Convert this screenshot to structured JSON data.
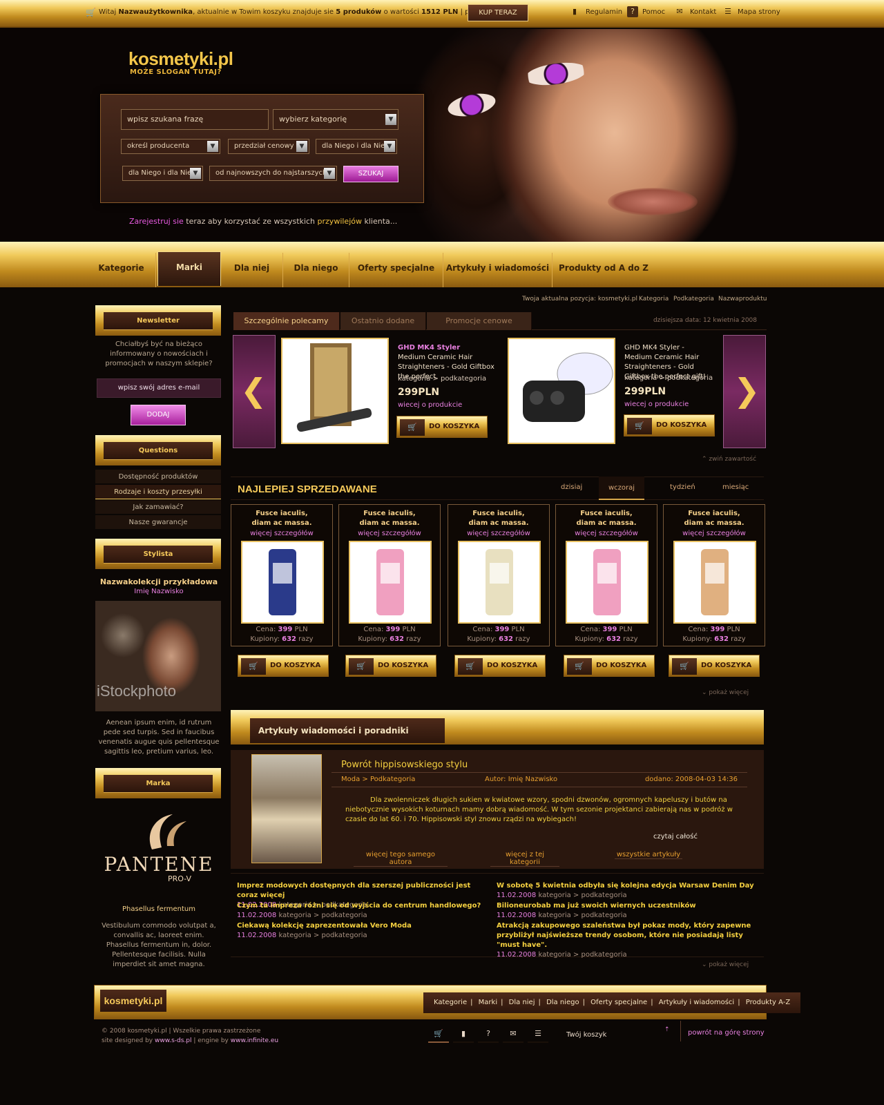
{
  "topbar": {
    "greeting_pre": "Witaj ",
    "greeting_user": "Nazwaużytkownika",
    "greeting_mid": ", aktualnie w Towim koszyku znajduje sie ",
    "greeting_count": "5 produków",
    "greeting_value_pre": " o wartości ",
    "greeting_value": "1512 PLN",
    "greeting_show": "  |  pokaż",
    "buy_now": "KUP TERAZ",
    "regulamin": "Regulamin",
    "pomoc": "Pomoc",
    "kontakt": "Kontakt",
    "mapa": "Mapa strony"
  },
  "header": {
    "logo": "kosmetyki.pl",
    "slogan": "MOŻE SLOGAN TUTAJ?"
  },
  "search": {
    "phrase": "wpisz szukana frazę",
    "category": "wybierz kategorię",
    "producer": "określ producenta",
    "price": "przedział cenowy",
    "gender1": "dla Niego i dla Niej",
    "gender2": "dla Niego i dla Niej",
    "sort": "od najnowszych do najstarszych",
    "button": "SZUKAJ"
  },
  "register": {
    "link": "Zarejestruj sie",
    "mid": " teraz aby korzystać ze wszystkich ",
    "priv": "przywilejów",
    "end": " klienta..."
  },
  "nav": {
    "items": [
      "Kategorie",
      "Marki",
      "Dla niej",
      "Dla niego",
      "Oferty specjalne",
      "Artykuły i wiadomości",
      "Produkty od A do Z"
    ],
    "active": "Marki"
  },
  "breadcrumb": {
    "prefix": "Twoja aktualna pozycja: kosmetyki.pl",
    "items": [
      "Kategoria",
      "Podkategoria",
      "Nazwaproduktu"
    ]
  },
  "sidebar": {
    "newsletter_title": "Newsletter",
    "newsletter_text": "Chciałbyś być na bieżąco informowany o nowościach i promocjach w naszym sklepie?",
    "email_placeholder": "wpisz swój adres e-mail",
    "add": "DODAJ",
    "questions_title": "Questions",
    "questions": [
      "Dostępność produktów",
      "Rodzaje i koszty przesyłki",
      "Jak zamawiać?",
      "Nasze gwarancje"
    ],
    "stylist_title": "Stylista",
    "stylist_collection": "Nazwakolekcji przykładowa",
    "stylist_name": "Imię Nazwisko",
    "stylist_watermark": "iStockphoto",
    "stylist_text": "Aenean ipsum enim, id rutrum pede sed turpis. Sed in faucibus venenatis augue quis pellentesque sagittis leo, pretium varius, leo.",
    "brand_title": "Marka",
    "brand_logo": "PANTENE",
    "brand_sub": "PRO-V",
    "brand_name": "Phasellus fermentum",
    "brand_text": "Vestibulum commodo volutpat a, convallis ac, laoreet enim. Phasellus fermentum in, dolor. Pellentesque facilisis. Nulla imperdiet sit amet magna."
  },
  "recommend": {
    "tabs": [
      "Szczególnie polecamy",
      "Ostatnio dodane",
      "Promocje cenowe"
    ],
    "date": "dzisiejsza data: 12 kwietnia 2008",
    "products": [
      {
        "name": "GHD MK4 Styler",
        "desc": " Medium Ceramic Hair Straighteners - Gold Giftbox the perfect",
        "cat": "kategoria > podkategoria",
        "price": "299PLN",
        "more": "wiecej o produkcie",
        "cart": "DO KOSZYKA"
      },
      {
        "name": "",
        "desc": "GHD MK4 Styler - Medium Ceramic Hair Straighteners - Gold Giftbox the perfect gift!",
        "cat": "kategoria > podkategoria",
        "price": "299PLN",
        "more": "wiecej o produkcie",
        "cart": "DO KOSZYKA"
      }
    ],
    "collapse": "zwiń zawartość"
  },
  "bestsellers": {
    "title": "NAJLEPIEJ SPRZEDAWANE",
    "tabs": [
      "dzisiaj",
      "wczoraj",
      "tydzień",
      "miesiąc"
    ],
    "active_tab": "wczoraj",
    "products": [
      {
        "t1": "Fusce iaculis,",
        "t2": "diam ac massa.",
        "more": "więcej szczegółów",
        "price_label": "Cena: ",
        "price": "399",
        "price_unit": " PLN",
        "bought_label": "Kupiony: ",
        "bought": "632",
        "bought_unit": " razy",
        "cart": "DO KOSZYKA"
      },
      {
        "t1": "Fusce iaculis,",
        "t2": "diam ac massa.",
        "more": "więcej szczegółów",
        "price_label": "Cena: ",
        "price": "399",
        "price_unit": " PLN",
        "bought_label": "Kupiony: ",
        "bought": "632",
        "bought_unit": " razy",
        "cart": "DO KOSZYKA"
      },
      {
        "t1": "Fusce iaculis,",
        "t2": "diam ac massa.",
        "more": "więcej szczegółów",
        "price_label": "Cena: ",
        "price": "399",
        "price_unit": " PLN",
        "bought_label": "Kupiony: ",
        "bought": "632",
        "bought_unit": " razy",
        "cart": "DO KOSZYKA"
      },
      {
        "t1": "Fusce iaculis,",
        "t2": "diam ac massa.",
        "more": "więcej szczegółów",
        "price_label": "Cena: ",
        "price": "399",
        "price_unit": " PLN",
        "bought_label": "Kupiony: ",
        "bought": "632",
        "bought_unit": " razy",
        "cart": "DO KOSZYKA"
      },
      {
        "t1": "Fusce iaculis,",
        "t2": "diam ac massa.",
        "more": "więcej szczegółów",
        "price_label": "Cena: ",
        "price": "399",
        "price_unit": " PLN",
        "bought_label": "Kupiony: ",
        "bought": "632",
        "bought_unit": " razy",
        "cart": "DO KOSZYKA"
      }
    ],
    "more": "pokaż więcej"
  },
  "articles": {
    "section_title": "Artykuły wiadomości i poradniki",
    "title": "Powrót hippisowskiego stylu",
    "cat": "Moda > Podkategoria",
    "author": "Autor: Imię Nazwisko",
    "added": "dodano: 2008-04-03 14:36",
    "body": "Dla zwolenniczek długich sukien w kwiatowe wzory, spodni dzwonów, ogromnych kapeluszy i butów na niebotycznie wysokich koturnach mamy dobrą wiadomość. W tym sezonie projektanci zabierają nas w podróż w czasie do lat 60. i 70. Hippisowski styl znowu rządzi na wybiegach!",
    "read_all": "czytaj całość",
    "links": [
      "więcej tego samego autora",
      "więcej z tej kategorii",
      "wszystkie artykuły"
    ],
    "news": [
      {
        "h": "Imprez modowych dostępnych dla szerszej publiczności jest coraz więcej",
        "d": "11.02.2008",
        "c": "kategoria > podkategoria"
      },
      {
        "h": "W sobotę 5 kwietnia odbyła się kolejna edycja Warsaw Denim Day",
        "d": "11.02.2008",
        "c": "kategoria > podkategoria"
      },
      {
        "h": "Czym ta impreza różni się od wyjścia do centrum handlowego?",
        "d": "11.02.2008",
        "c": "kategoria > podkategoria"
      },
      {
        "h": "Bilioneurobab ma już swoich wiernych uczestników",
        "d": "11.02.2008",
        "c": "kategoria > podkategoria"
      },
      {
        "h": "Ciekawą kolekcję zaprezentowała Vero Moda",
        "d": "11.02.2008",
        "c": "kategoria > podkategoria"
      },
      {
        "h": "Atrakcją zakupowego szaleństwa był pokaz mody, który zapewne przybliżył najświeższe trendy osobom, które nie posiadają listy \"must have\".",
        "d": "11.02.2008",
        "c": "kategoria > podkategoria"
      }
    ],
    "more": "pokaż więcej"
  },
  "footer": {
    "logo": "kosmetyki.pl",
    "nav": [
      "Kategorie",
      "Marki",
      "Dla niej",
      "Dla niego",
      "Oferty specjalne",
      "Artykuły i wiadomości",
      "Produkty A-Z"
    ],
    "copy1": "© 2008 kosmetyki.pl  |  Wszelkie prawa zastrzeżone",
    "designed": "site designed by ",
    "designer": "www.s-ds.pl",
    "engine": " | engine by ",
    "engine_url": "www.infinite.eu",
    "cart": "Twój koszyk",
    "top": "powrót na górę strony"
  }
}
